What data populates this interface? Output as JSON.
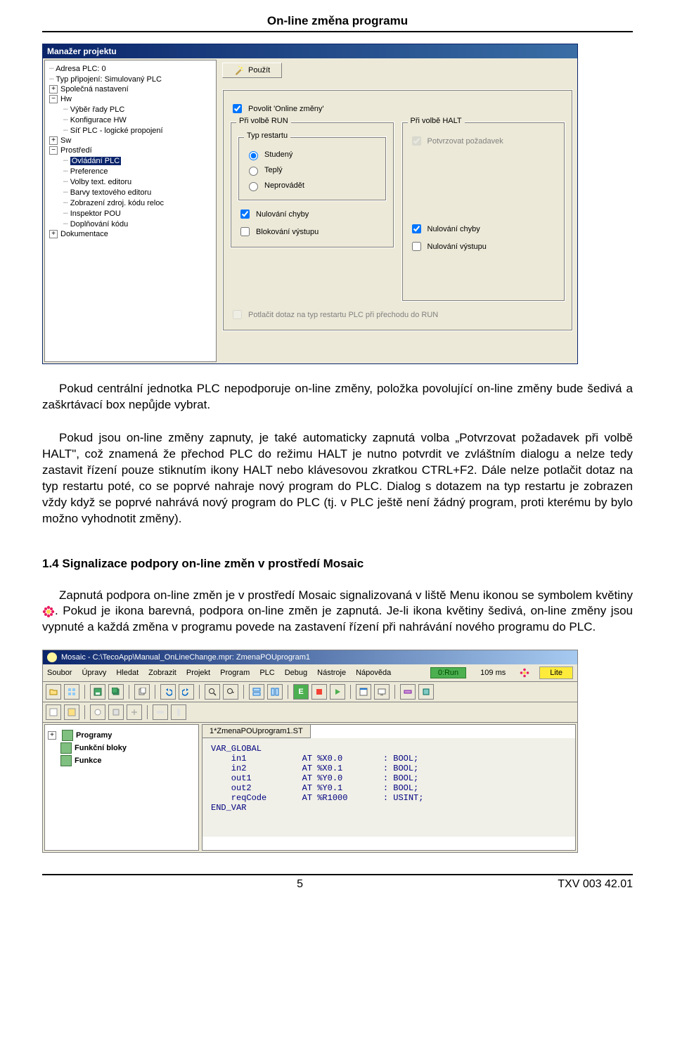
{
  "header": {
    "title": "On-line změna programu"
  },
  "dialog": {
    "title": "Manažer projektu",
    "tree": {
      "items": [
        {
          "label": "Adresa PLC: 0",
          "indent": 1,
          "expand": ""
        },
        {
          "label": "Typ připojení: Simulovaný PLC",
          "indent": 1,
          "expand": ""
        },
        {
          "label": "Společná nastavení",
          "indent": 1,
          "expand": "+"
        },
        {
          "label": "Hw",
          "indent": 1,
          "expand": "-"
        },
        {
          "label": "Výběr řady PLC",
          "indent": 2,
          "expand": ""
        },
        {
          "label": "Konfigurace HW",
          "indent": 2,
          "expand": ""
        },
        {
          "label": "Síť PLC - logické propojení",
          "indent": 2,
          "expand": ""
        },
        {
          "label": "Sw",
          "indent": 1,
          "expand": "+"
        },
        {
          "label": "Prostředí",
          "indent": 1,
          "expand": "-"
        },
        {
          "label": "Ovládání PLC",
          "indent": 2,
          "expand": "",
          "selected": true
        },
        {
          "label": "Preference",
          "indent": 2,
          "expand": ""
        },
        {
          "label": "Volby text. editoru",
          "indent": 2,
          "expand": ""
        },
        {
          "label": "Barvy textového editoru",
          "indent": 2,
          "expand": ""
        },
        {
          "label": "Zobrazení zdroj. kódu reloc",
          "indent": 2,
          "expand": ""
        },
        {
          "label": "Inspektor POU",
          "indent": 2,
          "expand": ""
        },
        {
          "label": "Doplňování kódu",
          "indent": 2,
          "expand": ""
        },
        {
          "label": "Dokumentace",
          "indent": 1,
          "expand": "+"
        }
      ]
    },
    "apply_btn": "Použít",
    "enable_online": "Povolit 'Online změny'",
    "group_run": {
      "legend": "Při volbě RUN",
      "restart_legend": "Typ restartu",
      "opt_cold": "Studený",
      "opt_warm": "Teplý",
      "opt_none": "Neprovádět",
      "chk_err": "Nulování chyby",
      "chk_block": "Blokování výstupu"
    },
    "group_halt": {
      "legend": "Při volbě HALT",
      "chk_confirm": "Potvrzovat požadavek",
      "chk_err": "Nulování chyby",
      "chk_out": "Nulování výstupu"
    },
    "suppress": "Potlačit dotaz na typ restartu PLC při přechodu do RUN"
  },
  "para1": "Pokud centrální jednotka PLC nepodporuje on-line změny, položka povolující on-line změny bude šedivá a zaškrtávací box nepůjde vybrat.",
  "para2": "Pokud jsou on-line změny zapnuty, je také automaticky zapnutá volba „Potvrzovat požadavek při volbě HALT\", což znamená že přechod PLC do režimu HALT je nutno potvrdit ve zvláštním dialogu a nelze tedy zastavit řízení pouze stiknutím ikony HALT nebo klávesovou zkratkou CTRL+F2. Dále nelze potlačit dotaz na typ restartu poté, co se poprvé nahraje nový program do PLC. Dialog s dotazem na typ restartu je zobrazen vždy když se poprvé nahrává nový program do PLC (tj. v PLC ještě není žádný program, proti kterému by bylo možno vyhodnotit změny).",
  "section_title": "1.4 Signalizace podpory on-line změn v prostředí Mosaic",
  "para3a": "Zapnutá podpora on-line změn je v prostředí Mosaic signalizovaná v liště Menu ikonou se symbolem květiny ",
  "para3b": ". Pokud je ikona barevná, podpora on-line změn je zapnutá. Je-li ikona květiny šedivá, on-line změny jsou vypnuté a každá změna v programu povede na zastavení řízení při nahrávání nového programu do PLC.",
  "app": {
    "title": "Mosaic - C:\\TecoApp\\Manual_OnLineChange.mpr: ZmenaPOUprogram1",
    "menu": [
      "Soubor",
      "Úpravy",
      "Hledat",
      "Zobrazit",
      "Projekt",
      "Program",
      "PLC",
      "Debug",
      "Nástroje",
      "Nápověda"
    ],
    "run_badge": "0:Run",
    "ms": "109 ms",
    "lite": "Lite",
    "tree": {
      "programs": "Programy",
      "fb": "Funkční bloky",
      "fn": "Funkce"
    },
    "tab": "1*ZmenaPOUprogram1.ST",
    "code": "VAR_GLOBAL\n    in1           AT %X0.0        : BOOL;\n    in2           AT %X0.1        : BOOL;\n    out1          AT %Y0.0        : BOOL;\n    out2          AT %Y0.1        : BOOL;\n    reqCode       AT %R1000       : USINT;\nEND_VAR"
  },
  "footer": {
    "page": "5",
    "doc": "TXV 003 42.01"
  }
}
